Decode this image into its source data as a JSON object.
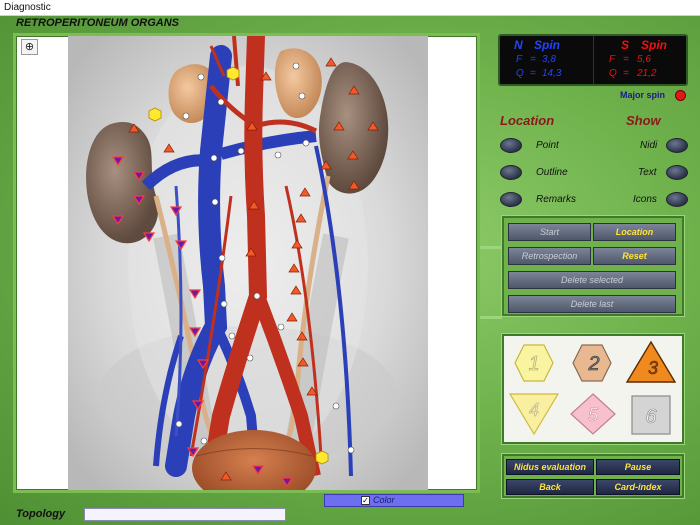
{
  "window": {
    "title": "Diagnostic"
  },
  "organ_title": "RETROPERITONEUM ORGANS",
  "viewer": {
    "zoom_icon": "zoom-in-icon"
  },
  "spin": {
    "n": {
      "label_n": "N",
      "label_spin": "Spin",
      "f_label": "F",
      "f_value": "3,8",
      "q_label": "Q",
      "q_value": "14,3"
    },
    "s": {
      "label_s": "S",
      "label_spin": "Spin",
      "f_label": "F",
      "f_value": "5,6",
      "q_label": "Q",
      "q_value": "21,2"
    },
    "major_label": "Major spin",
    "major_color": "#e01818"
  },
  "location": {
    "heading": "Location",
    "items": [
      "Point",
      "Outline",
      "Remarks"
    ]
  },
  "show": {
    "heading": "Show",
    "items": [
      "Nidi",
      "Text",
      "Icons"
    ]
  },
  "controls": {
    "start": "Start",
    "location": "Location",
    "retrospection": "Retrospection",
    "reset": "Reset",
    "delete_selected": "Delete selected",
    "delete_last": "Delete last"
  },
  "nidi": [
    {
      "num": "1",
      "shape": "hexagon",
      "color": "#f8f4a0"
    },
    {
      "num": "2",
      "shape": "hexagon",
      "color": "#e8b890"
    },
    {
      "num": "3",
      "shape": "triangle-up",
      "color": "#f08a1e"
    },
    {
      "num": "4",
      "shape": "triangle-down",
      "color": "#f8f0a0"
    },
    {
      "num": "5",
      "shape": "diamond",
      "color": "#f7c0cc"
    },
    {
      "num": "6",
      "shape": "square",
      "color": "#d4d4d4"
    }
  ],
  "footer_buttons": {
    "nidus_evaluation": "Nidus evaluation",
    "pause": "Pause",
    "back": "Back",
    "card_index": "Card-index"
  },
  "color_toggle": {
    "label": "Color",
    "checked": true
  },
  "topology": {
    "label": "Topology",
    "value": ""
  }
}
